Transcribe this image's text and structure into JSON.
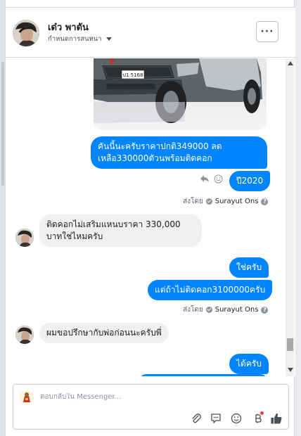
{
  "colors": {
    "accent": "#0084ff",
    "incoming": "#f1f0f0",
    "like": "#4b4f56"
  },
  "header": {
    "name": "เด๋ว พาดัน",
    "subtitle": "กำหนดการสนทนา",
    "more_label": "···"
  },
  "messages": {
    "out_1": "คันนี้นะครับราคาปกติ349000 ลดเหลือ330000ตัวนพร้อมติดคอก",
    "out_2": "ปี2020",
    "sent_by_prefix_1": "ส่งโดย",
    "sent_by_name_1": "Surayut Ons",
    "in_1": "ติดคอกไม่เสริมแหนบราคา 330,000 บาทใช่ไหมครับ",
    "out_3": "ใช่ครับ",
    "out_4": "แต่ถ้าไม่ติดคอก3100000ครับ",
    "sent_by_prefix_2": "ส่งโดย",
    "sent_by_name_2": "Surayut Ons",
    "in_2": "ผมขอปรึกษากับพ่อก่อนนะครับพี่",
    "out_5": "ได้ครับ"
  },
  "car": {
    "plate": "ป1 5168"
  },
  "composer": {
    "placeholder": "ตอบกลับใน Messenger..."
  },
  "icons": [
    "more-icon",
    "reply-icon",
    "emoji-icon",
    "info-icon",
    "attachment-icon",
    "sticker-icon",
    "gif-icon",
    "like-icon"
  ]
}
